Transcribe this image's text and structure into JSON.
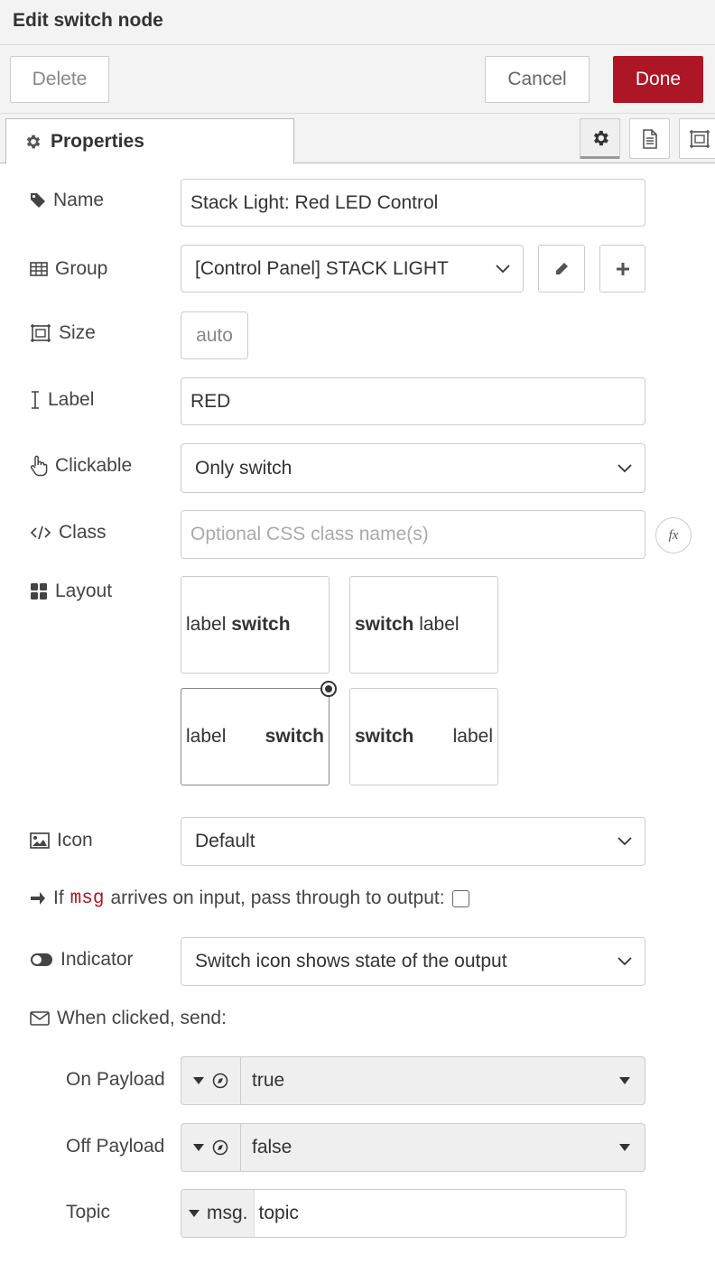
{
  "dialog": {
    "title": "Edit switch node",
    "delete_label": "Delete",
    "cancel_label": "Cancel",
    "done_label": "Done",
    "done_color": "#ad1625"
  },
  "tabs": {
    "properties_label": "Properties",
    "icons": [
      "gear-icon",
      "document-icon",
      "frame-icon"
    ]
  },
  "form": {
    "name": {
      "label": "Name",
      "value": "Stack Light: Red LED Control"
    },
    "group": {
      "label": "Group",
      "value": "[Control Panel] STACK LIGHT"
    },
    "size": {
      "label": "Size",
      "value": "auto"
    },
    "label_field": {
      "label": "Label",
      "value": "RED"
    },
    "clickable": {
      "label": "Clickable",
      "value": "Only switch"
    },
    "class": {
      "label": "Class",
      "placeholder": "Optional CSS class name(s)",
      "fx": "fx"
    },
    "layout": {
      "label": "Layout",
      "options": [
        {
          "a": "label",
          "b": "switch"
        },
        {
          "a": "switch",
          "b": "label"
        },
        {
          "a": "label",
          "b": "switch"
        },
        {
          "a": "switch",
          "b": "label"
        }
      ],
      "selected_index": 2
    },
    "icon": {
      "label": "Icon",
      "value": "Default"
    },
    "passthrough": {
      "prefix": "If",
      "code": "msg",
      "suffix": "arrives on input, pass through to output:",
      "checked": false
    },
    "indicator": {
      "label": "Indicator",
      "value": "Switch icon shows state of the output"
    },
    "when_clicked": {
      "label": "When clicked, send:"
    },
    "on_payload": {
      "label": "On Payload",
      "value": "true"
    },
    "off_payload": {
      "label": "Off Payload",
      "value": "false"
    },
    "topic": {
      "label": "Topic",
      "prefix": "msg.",
      "value": "topic"
    }
  }
}
